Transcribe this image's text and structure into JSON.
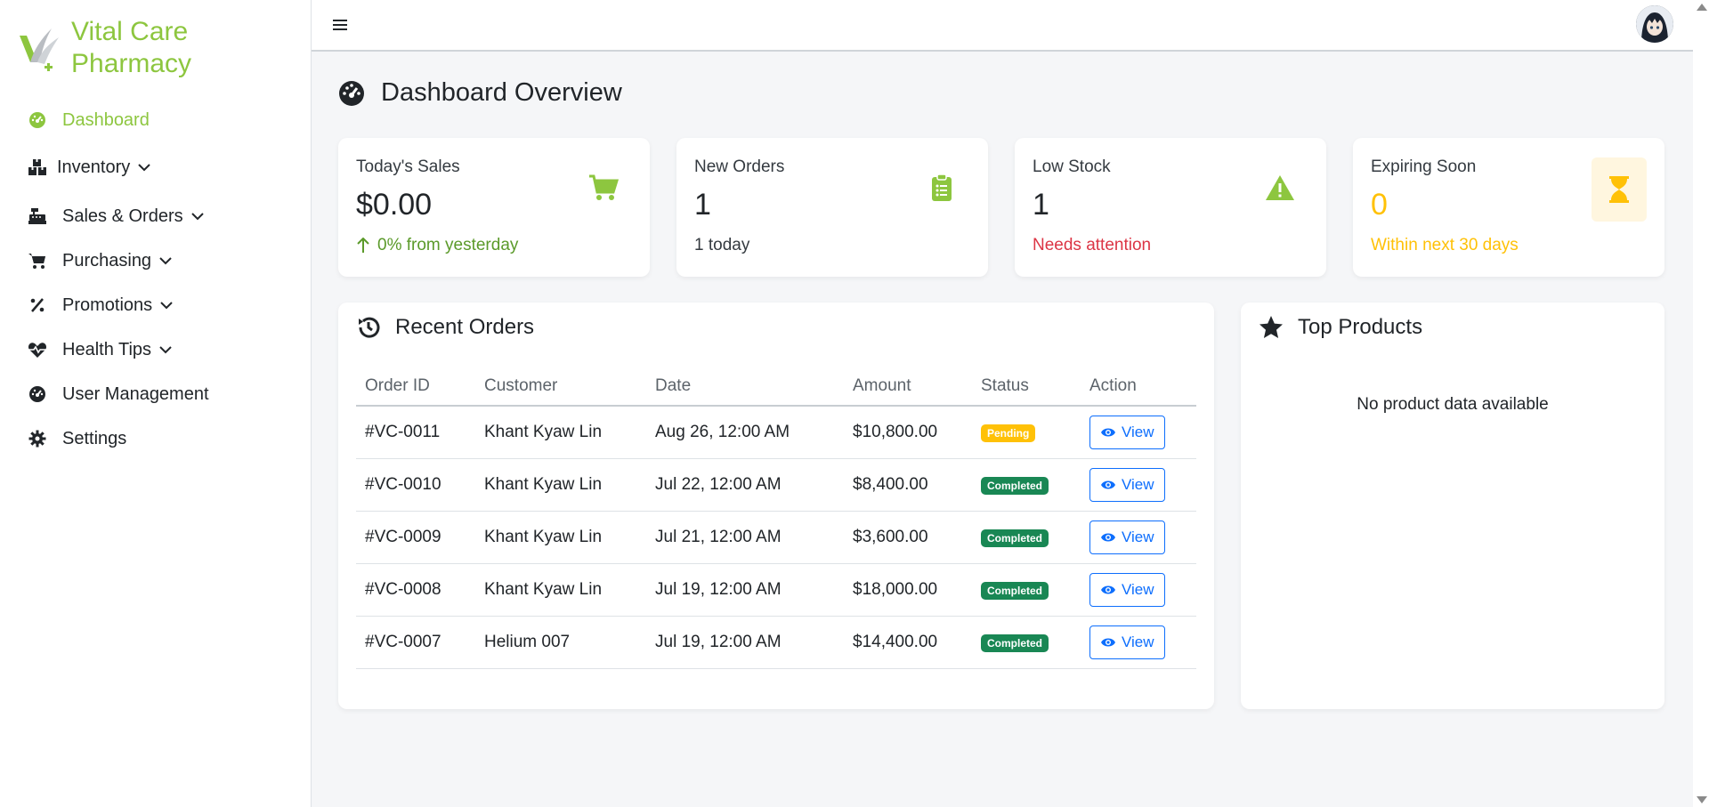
{
  "brand": {
    "line1": "Vital Care",
    "line2": "Pharmacy",
    "color": "#8dc63f"
  },
  "sidebar": {
    "items": [
      {
        "label": "Dashboard",
        "icon": "gauge-icon",
        "active": true
      },
      {
        "label": "Inventory",
        "icon": "boxes-icon",
        "expandable": true
      },
      {
        "label": "Sales & Orders",
        "icon": "cash-register-icon",
        "expandable": true
      },
      {
        "label": "Purchasing",
        "icon": "cart-icon",
        "expandable": true
      },
      {
        "label": "Promotions",
        "icon": "percent-icon",
        "expandable": true
      },
      {
        "label": "Health Tips",
        "icon": "heart-pulse-icon",
        "expandable": true
      },
      {
        "label": "User Management",
        "icon": "gauge-icon"
      },
      {
        "label": "Settings",
        "icon": "gear-icon"
      }
    ]
  },
  "header": {
    "menu_icon": "hamburger-icon",
    "avatar": "user-avatar"
  },
  "page": {
    "title": "Dashboard Overview"
  },
  "stats": [
    {
      "label": "Today's Sales",
      "value": "$0.00",
      "sub": "0% from yesterday",
      "icon": "cart-icon",
      "color": "#8dc63f"
    },
    {
      "label": "New Orders",
      "value": "1",
      "sub": "1 today",
      "icon": "clipboard-list-icon",
      "color": "#8dc63f"
    },
    {
      "label": "Low Stock",
      "value": "1",
      "sub": "Needs attention",
      "icon": "warning-icon",
      "color": "#dc3545"
    },
    {
      "label": "Expiring Soon",
      "value": "0",
      "sub": "Within next 30 days",
      "icon": "hourglass-icon",
      "color": "#ffc107"
    }
  ],
  "recent_orders": {
    "title": "Recent Orders",
    "columns": [
      "Order ID",
      "Customer",
      "Date",
      "Amount",
      "Status",
      "Action"
    ],
    "rows": [
      {
        "id": "#VC-0011",
        "customer": "Khant Kyaw Lin",
        "date": "Aug 26, 12:00 AM",
        "amount": "$10,800.00",
        "status": "Pending",
        "action": "View"
      },
      {
        "id": "#VC-0010",
        "customer": "Khant Kyaw Lin",
        "date": "Jul 22, 12:00 AM",
        "amount": "$8,400.00",
        "status": "Completed",
        "action": "View"
      },
      {
        "id": "#VC-0009",
        "customer": "Khant Kyaw Lin",
        "date": "Jul 21, 12:00 AM",
        "amount": "$3,600.00",
        "status": "Completed",
        "action": "View"
      },
      {
        "id": "#VC-0008",
        "customer": "Khant Kyaw Lin",
        "date": "Jul 19, 12:00 AM",
        "amount": "$18,000.00",
        "status": "Completed",
        "action": "View"
      },
      {
        "id": "#VC-0007",
        "customer": "Helium 007",
        "date": "Jul 19, 12:00 AM",
        "amount": "$14,400.00",
        "status": "Completed",
        "action": "View"
      }
    ]
  },
  "top_products": {
    "title": "Top Products",
    "empty_text": "No product data available"
  }
}
